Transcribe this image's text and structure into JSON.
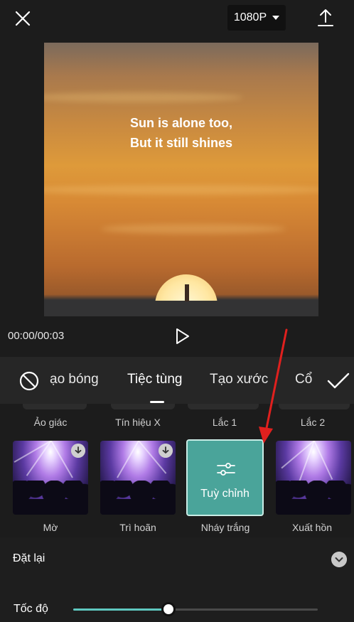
{
  "topbar": {
    "resolution": "1080P",
    "close_icon": "close-icon",
    "export_icon": "export-upload-icon"
  },
  "preview": {
    "lyric_line1": "Sun is alone too,",
    "lyric_line2": "But it still shines"
  },
  "playback": {
    "timecode": "00:00/00:03",
    "play_icon": "play-icon"
  },
  "categories": {
    "items": [
      "ạo bóng",
      "Tiệc tùng",
      "Tạo xước",
      "Cổ"
    ],
    "active": "Tiệc tùng",
    "none_icon": "no-effect-icon",
    "confirm_icon": "checkmark-icon"
  },
  "effects": {
    "top_row_labels": [
      "Ảo giác",
      "Tín hiệu X",
      "Lắc 1",
      "Lắc 2"
    ],
    "cards": [
      {
        "caption": "Mờ",
        "downloadable": true
      },
      {
        "caption": "Trì hoãn",
        "downloadable": true
      },
      {
        "caption": "Nháy trắng",
        "selected": true,
        "overlay_label": "Tuỳ chỉnh"
      },
      {
        "caption": "Xuất hồn",
        "downloadable": false
      }
    ],
    "selected_color": "#4aa49a"
  },
  "reset": {
    "label": "Đặt lại",
    "chevron_icon": "chevron-down-icon"
  },
  "speed": {
    "label": "Tốc độ",
    "value_fraction": 0.39
  },
  "annotation": {
    "arrow_color": "#e0201e"
  }
}
